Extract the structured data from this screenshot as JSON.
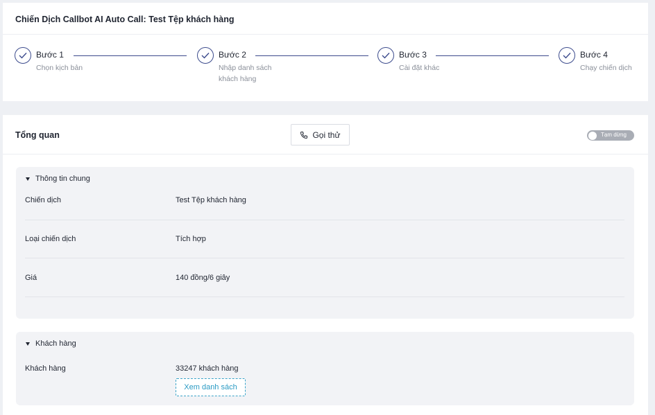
{
  "header": {
    "title": "Chiến Dịch Callbot AI Auto Call: Test Tệp khách hàng"
  },
  "steps": [
    {
      "label": "Bước 1",
      "sub": "Chọn kịch bản"
    },
    {
      "label": "Bước 2",
      "sub": "Nhập danh sách khách hàng"
    },
    {
      "label": "Bước 3",
      "sub": "Cài đặt khác"
    },
    {
      "label": "Bước 4",
      "sub": "Chạy chiến dịch"
    }
  ],
  "overview": {
    "title": "Tổng quan",
    "call_button": "Gọi thử",
    "toggle_label": "Tạm dừng"
  },
  "general": {
    "title": "Thông tin chung",
    "rows": [
      {
        "key": "Chiến dịch",
        "value": "Test Tệp khách hàng"
      },
      {
        "key": "Loại chiến dịch",
        "value": "Tích hợp"
      },
      {
        "key": "Giá",
        "value": "140 đồng/6 giây"
      }
    ]
  },
  "customers": {
    "title": "Khách hàng",
    "row_key": "Khách hàng",
    "row_value": "33247 khách hàng",
    "view_button": "Xem danh sách"
  },
  "colors": {
    "accent": "#3b4a8c",
    "link": "#2b9bc4",
    "background": "#eef0f4"
  },
  "icons": {
    "step": "check-circle-icon",
    "call": "phone-icon",
    "collapse": "caret-down-icon"
  }
}
